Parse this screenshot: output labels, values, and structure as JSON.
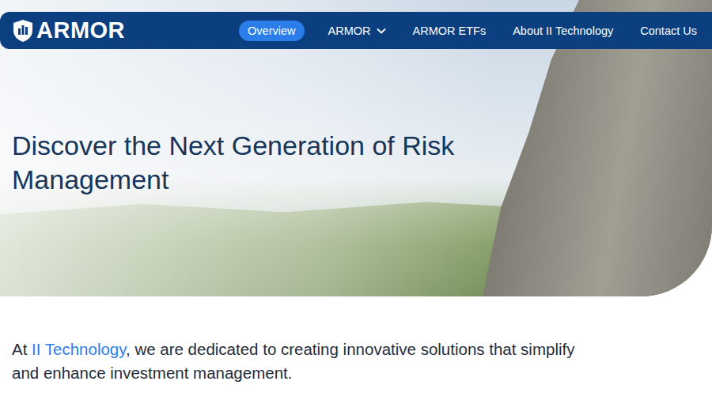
{
  "logo": {
    "text": "ARMOR"
  },
  "nav": {
    "items": [
      {
        "label": "Overview",
        "selected": true,
        "dropdown": false
      },
      {
        "label": "ARMOR",
        "selected": false,
        "dropdown": true
      },
      {
        "label": "ARMOR ETFs",
        "selected": false,
        "dropdown": false
      },
      {
        "label": "About II Technology",
        "selected": false,
        "dropdown": false
      },
      {
        "label": "Contact Us",
        "selected": false,
        "dropdown": false
      }
    ]
  },
  "hero": {
    "heading": "Discover the Next Generation of Risk Management"
  },
  "intro": {
    "prefix": "At ",
    "link": "II Technology",
    "suffix": ", we are dedicated to creating innovative solutions that simplify and enhance investment management."
  }
}
